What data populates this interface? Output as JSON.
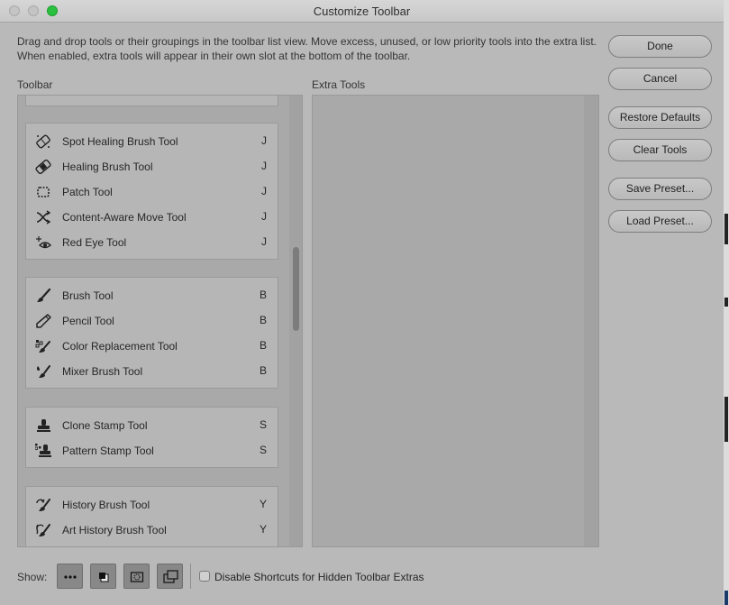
{
  "window": {
    "title": "Customize Toolbar",
    "description": "Drag and drop tools or their groupings in the toolbar list view. Move excess, unused, or low priority tools into the extra list. When enabled, extra tools will appear in their own slot at the bottom of the toolbar."
  },
  "toolbar": {
    "label": "Toolbar",
    "groups": [
      {
        "tools": [
          {
            "name": "Spot Healing Brush Tool",
            "key": "J",
            "icon": "spot-healing-brush-icon"
          },
          {
            "name": "Healing Brush Tool",
            "key": "J",
            "icon": "healing-brush-icon"
          },
          {
            "name": "Patch Tool",
            "key": "J",
            "icon": "patch-icon"
          },
          {
            "name": "Content-Aware Move Tool",
            "key": "J",
            "icon": "content-aware-move-icon"
          },
          {
            "name": "Red Eye Tool",
            "key": "J",
            "icon": "red-eye-icon"
          }
        ]
      },
      {
        "tools": [
          {
            "name": "Brush Tool",
            "key": "B",
            "icon": "brush-icon"
          },
          {
            "name": "Pencil Tool",
            "key": "B",
            "icon": "pencil-icon"
          },
          {
            "name": "Color Replacement Tool",
            "key": "B",
            "icon": "color-replacement-icon"
          },
          {
            "name": "Mixer Brush Tool",
            "key": "B",
            "icon": "mixer-brush-icon"
          }
        ]
      },
      {
        "tools": [
          {
            "name": "Clone Stamp Tool",
            "key": "S",
            "icon": "clone-stamp-icon"
          },
          {
            "name": "Pattern Stamp Tool",
            "key": "S",
            "icon": "pattern-stamp-icon"
          }
        ]
      },
      {
        "tools": [
          {
            "name": "History Brush Tool",
            "key": "Y",
            "icon": "history-brush-icon"
          },
          {
            "name": "Art History Brush Tool",
            "key": "Y",
            "icon": "art-history-brush-icon"
          }
        ]
      }
    ]
  },
  "extra": {
    "label": "Extra Tools"
  },
  "buttons": {
    "done": "Done",
    "cancel": "Cancel",
    "restore": "Restore Defaults",
    "clear": "Clear Tools",
    "save": "Save Preset...",
    "load": "Load Preset..."
  },
  "footer": {
    "show_label": "Show:",
    "show_buttons": [
      "more-icon",
      "foreground-background-icon",
      "quick-mask-icon",
      "screen-mode-icon"
    ],
    "checkbox_label": "Disable Shortcuts for Hidden Toolbar Extras",
    "checkbox_checked": false
  }
}
